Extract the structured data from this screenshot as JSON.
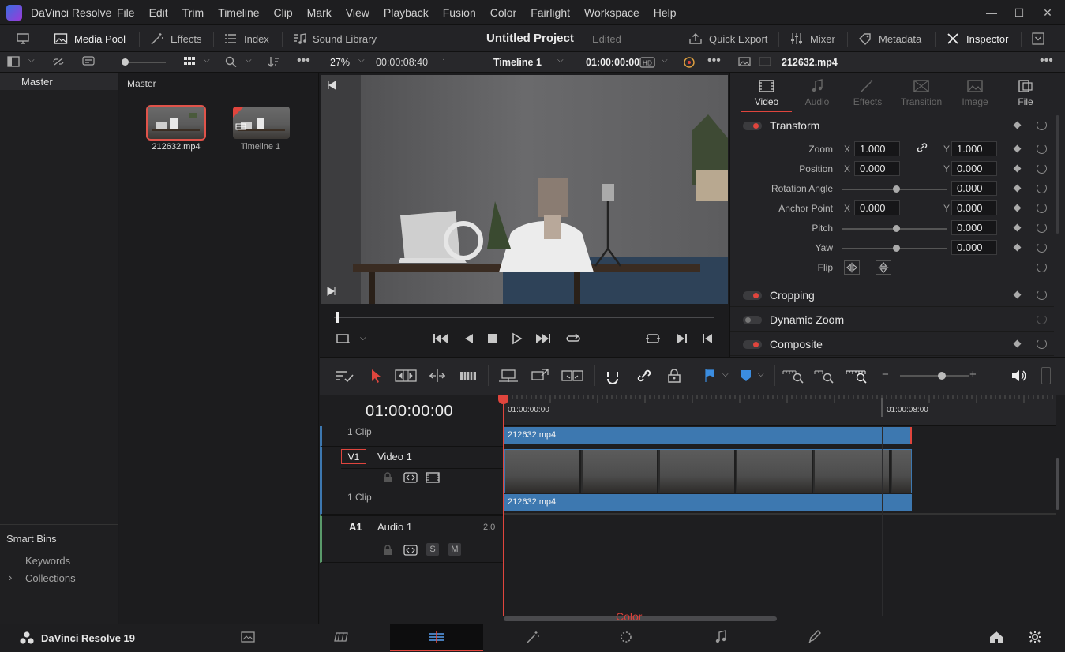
{
  "app": {
    "name": "DaVinci Resolve",
    "menus": [
      "File",
      "Edit",
      "Trim",
      "Timeline",
      "Clip",
      "Mark",
      "View",
      "Playback",
      "Fusion",
      "Color",
      "Fairlight",
      "Workspace",
      "Help"
    ]
  },
  "toolbar": {
    "media_pool": "Media Pool",
    "effects": "Effects",
    "index": "Index",
    "sound_library": "Sound Library",
    "project_title": "Untitled Project",
    "project_status": "Edited",
    "quick_export": "Quick Export",
    "mixer": "Mixer",
    "metadata": "Metadata",
    "inspector": "Inspector"
  },
  "subbar": {
    "zoom": "27%",
    "duration": "00:00:08:40",
    "timeline_name": "Timeline 1",
    "timecode": "01:00:00:00",
    "clip_name": "212632.mp4"
  },
  "sidebar": {
    "master": "Master",
    "smart_bins": "Smart Bins",
    "keywords": "Keywords",
    "collections": "Collections"
  },
  "mediapool": {
    "header": "Master",
    "items": [
      {
        "label": "212632.mp4"
      },
      {
        "label": "Timeline 1"
      }
    ]
  },
  "inspector": {
    "tabs": [
      "Video",
      "Audio",
      "Effects",
      "Transition",
      "Image",
      "File"
    ],
    "transform": {
      "title": "Transform",
      "zoom_label": "Zoom",
      "zoom_x": "1.000",
      "zoom_y": "1.000",
      "position_label": "Position",
      "position_x": "0.000",
      "position_y": "0.000",
      "rotation_label": "Rotation Angle",
      "rotation": "0.000",
      "anchor_label": "Anchor Point",
      "anchor_x": "0.000",
      "anchor_y": "0.000",
      "pitch_label": "Pitch",
      "pitch": "0.000",
      "yaw_label": "Yaw",
      "yaw": "0.000",
      "flip_label": "Flip",
      "x": "X",
      "y": "Y"
    },
    "cropping": "Cropping",
    "dynamic_zoom": "Dynamic Zoom",
    "composite": "Composite"
  },
  "timeline": {
    "timecode": "01:00:00:00",
    "ruler_start": "01:00:00:00",
    "ruler_mark": "01:00:08:00",
    "v_top_count": "1 Clip",
    "v1_badge": "V1",
    "v1_name": "Video 1",
    "v1_count": "1 Clip",
    "a1_badge": "A1",
    "a1_name": "Audio 1",
    "a1_channels": "2.0",
    "solo": "S",
    "mute": "M",
    "clip_top": "212632.mp4",
    "clip_v1": "212632.mp4"
  },
  "pagebar": {
    "product": "DaVinci Resolve 19",
    "hover_label": "Color"
  },
  "colors": {
    "accent_red": "#e0453d",
    "clip_blue": "#3d78b0"
  }
}
